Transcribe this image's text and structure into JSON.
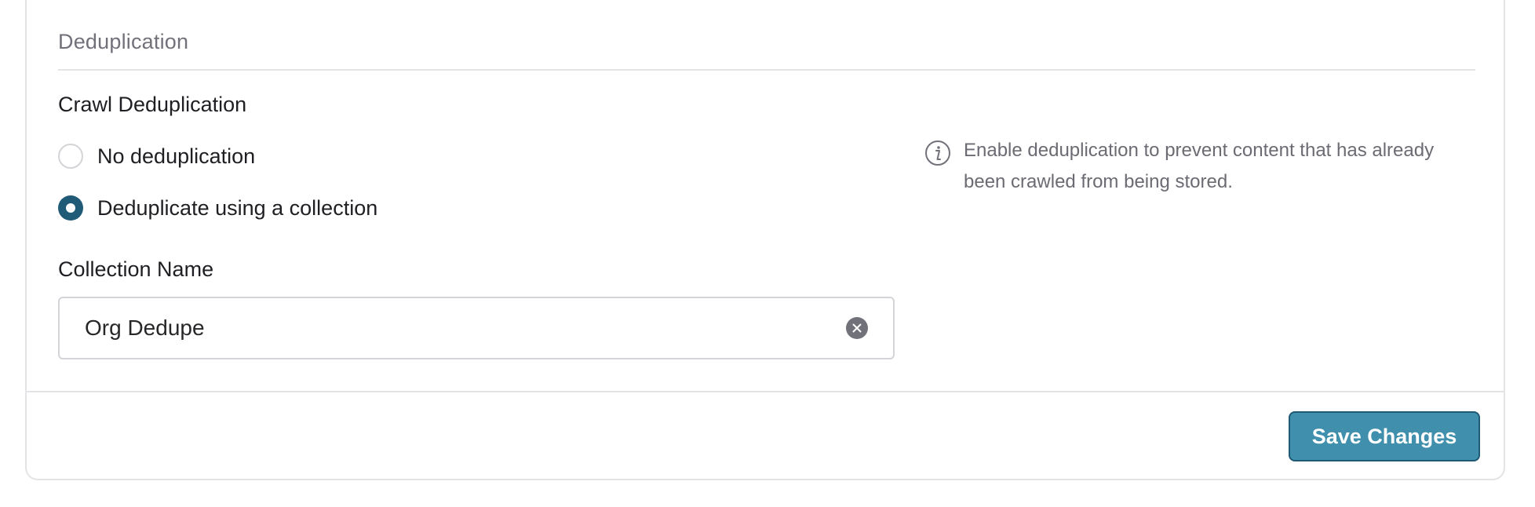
{
  "section": {
    "title": "Deduplication"
  },
  "dedup": {
    "label": "Crawl Deduplication",
    "options": [
      {
        "label": "No deduplication",
        "selected": false
      },
      {
        "label": "Deduplicate using a collection",
        "selected": true
      }
    ],
    "help_icon": "info-icon",
    "help_text": "Enable deduplication to prevent content that has already been crawled from being stored."
  },
  "collection": {
    "label": "Collection Name",
    "value": "Org Dedupe",
    "clear_icon": "clear-x-icon"
  },
  "footer": {
    "save_label": "Save Changes"
  },
  "colors": {
    "accent": "#1f5a76",
    "button": "#3f8fad",
    "muted_text": "#71717a",
    "border": "#e4e4e7"
  }
}
